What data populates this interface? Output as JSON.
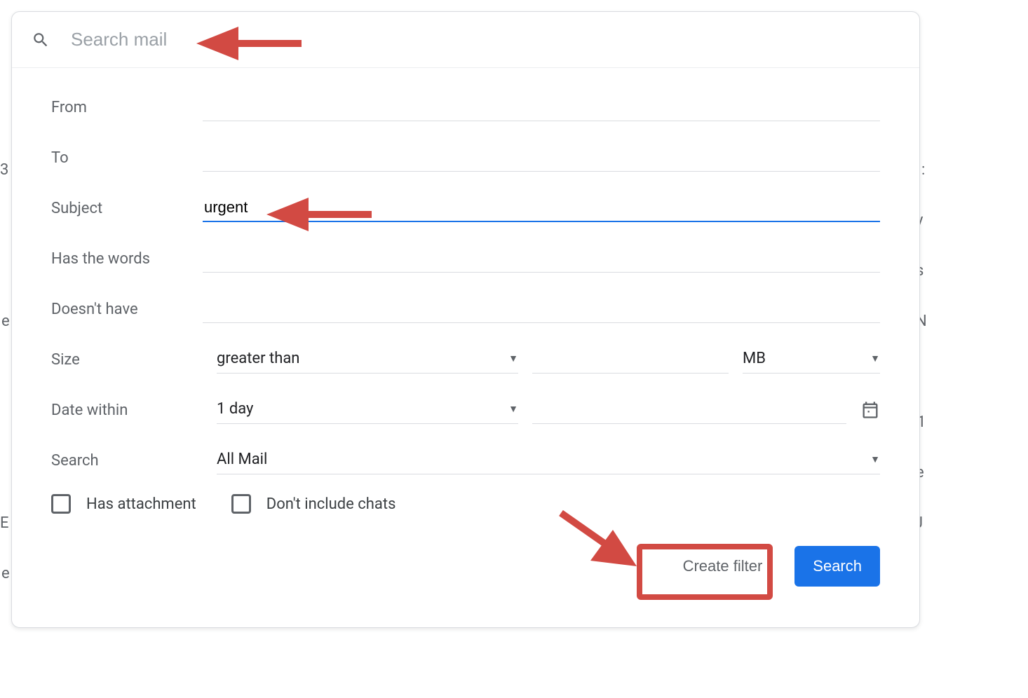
{
  "search": {
    "placeholder": "Search mail",
    "value": ""
  },
  "labels": {
    "from": "From",
    "to": "To",
    "subject": "Subject",
    "has_words": "Has the words",
    "doesnt_have": "Doesn't have",
    "size": "Size",
    "date_within": "Date within",
    "search_in": "Search"
  },
  "values": {
    "from": "",
    "to": "",
    "subject": "urgent",
    "has_words": "",
    "doesnt_have": "",
    "size_comparator": "greater than",
    "size_amount": "",
    "size_unit": "MB",
    "date_range": "1 day",
    "date_value": "",
    "search_scope": "All Mail"
  },
  "checkboxes": {
    "has_attachment_label": "Has attachment",
    "has_attachment_checked": false,
    "dont_include_chats_label": "Don't include chats",
    "dont_include_chats_checked": false
  },
  "buttons": {
    "create_filter": "Create filter",
    "search": "Search"
  },
  "background_fragments": [
    "3",
    "e",
    "E",
    "e",
    "y",
    "s",
    "N",
    "1",
    "e",
    "J",
    ":"
  ]
}
